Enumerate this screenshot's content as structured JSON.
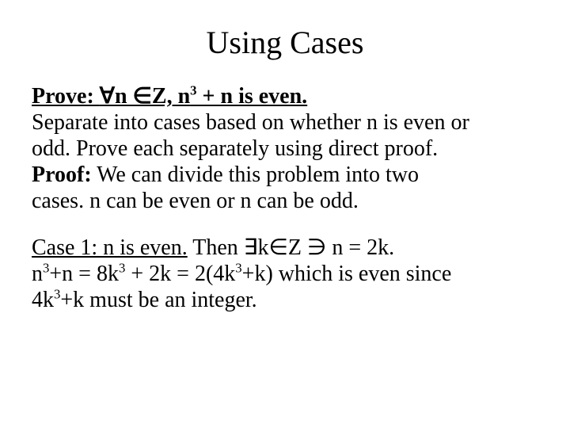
{
  "title": "Using Cases",
  "prove_label": "Prove: ",
  "prove_stmt_pre": "n ",
  "prove_stmt_mid": "Z, n",
  "prove_stmt_post": " + n is even.",
  "forall": "∀",
  "elem": "∈",
  "exists": "∃",
  "ni": "∋",
  "exp3": "3",
  "para1a": "Separate into cases based on whether n is even or",
  "para1b": "odd.  Prove each separately using direct proof.",
  "proof_label": "Proof:",
  "para2a": "  We can divide this problem into two",
  "para2b": "cases. n can be even or n can be odd.",
  "case1_label": "Case 1: n is even.",
  "case1_then": " Then ",
  "case1_k_pre": "k",
  "case1_z": "Z ",
  "case1_eq": " n = 2k.",
  "line2a": "n",
  "line2b": "+n = 8k",
  "line2c": " + 2k = 2(4k",
  "line2d": "+k) which is even since",
  "line3a": "4k",
  "line3b": "+k must be an integer."
}
